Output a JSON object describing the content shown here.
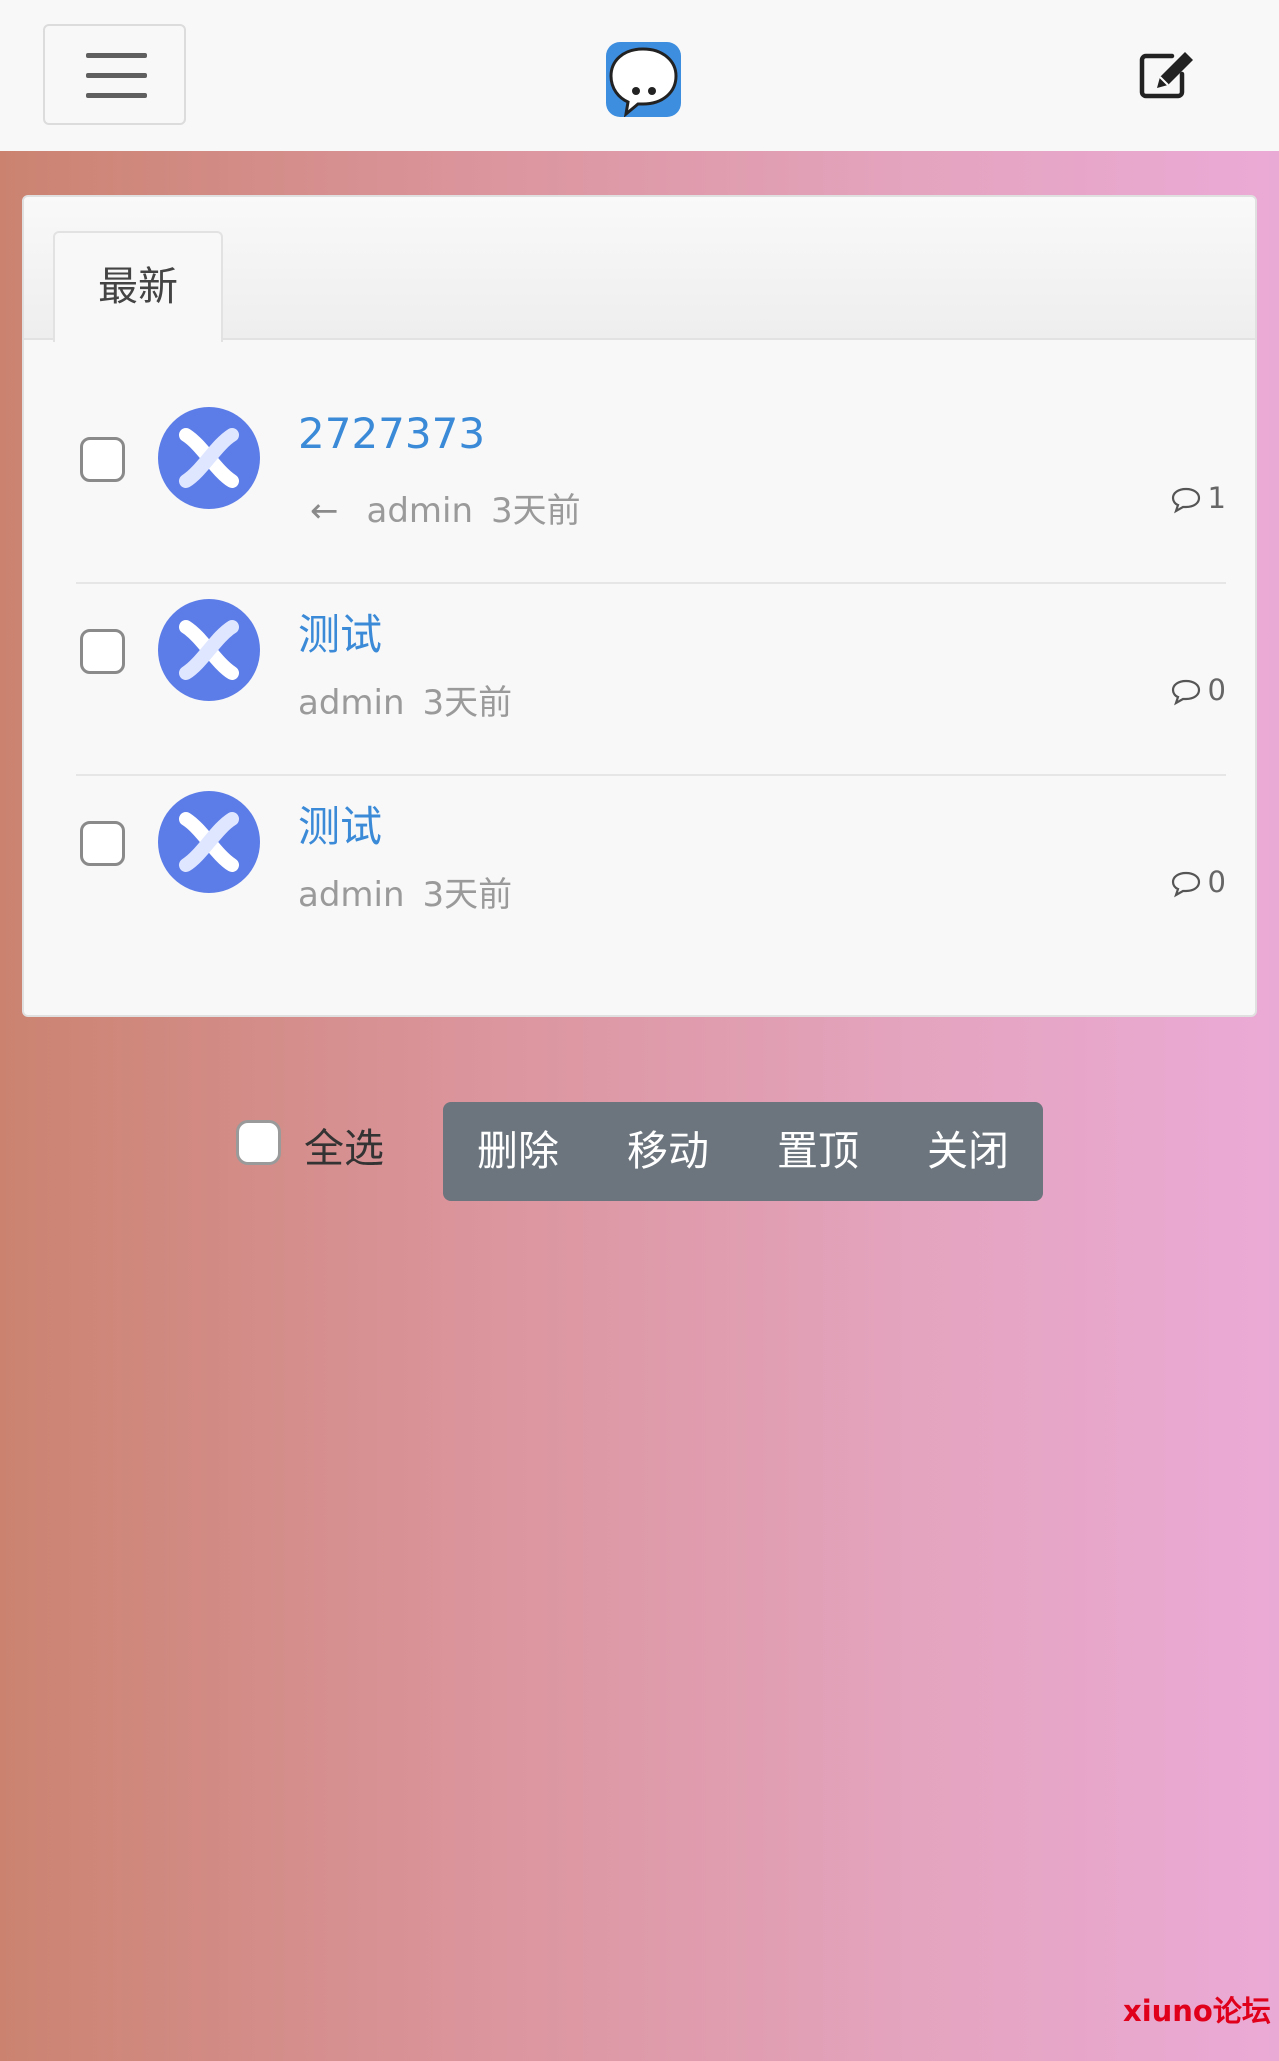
{
  "header": {
    "menu_icon": "hamburger-menu-icon",
    "logo_icon": "chat-bubble-logo-icon",
    "edit_icon": "edit-compose-icon"
  },
  "tabs": [
    {
      "label": "最新",
      "active": true
    }
  ],
  "threads": [
    {
      "title": "2727373",
      "has_arrow": true,
      "arrow": "←",
      "author": "admin",
      "time": "3天前",
      "comments": "1"
    },
    {
      "title": "测试",
      "has_arrow": false,
      "author": "admin",
      "time": "3天前",
      "comments": "0"
    },
    {
      "title": "测试",
      "has_arrow": false,
      "author": "admin",
      "time": "3天前",
      "comments": "0"
    }
  ],
  "actions": {
    "select_all_label": "全选",
    "buttons": [
      "删除",
      "移动",
      "置顶",
      "关闭"
    ]
  },
  "watermark": "xiuno论坛",
  "colors": {
    "accent": "#3a8ad8",
    "avatar": "#5c7de8",
    "button_group": "#6c757d",
    "watermark": "#e0001b"
  }
}
